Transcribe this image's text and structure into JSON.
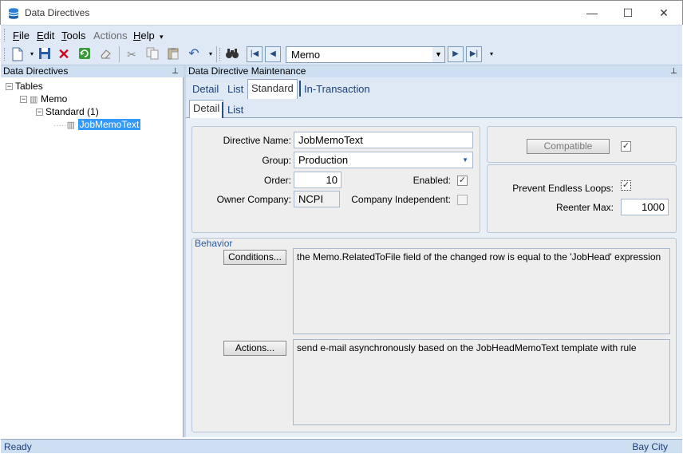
{
  "window": {
    "title": "Data Directives",
    "icon": "database-icon",
    "minimize": "—",
    "maximize": "☐",
    "close": "✕"
  },
  "menu": {
    "items": [
      {
        "label": "File",
        "accel": "F",
        "rest": "ile"
      },
      {
        "label": "Edit",
        "accel": "E",
        "rest": "dit"
      },
      {
        "label": "Tools",
        "accel": "T",
        "rest": "ools"
      },
      {
        "label": "Actions",
        "accel": "",
        "rest": "Actions"
      },
      {
        "label": "Help",
        "accel": "H",
        "rest": "elp"
      }
    ],
    "overflow": "▾"
  },
  "toolbar": {
    "record_value": "Memo",
    "overflow": "▾"
  },
  "left_panel": {
    "title": "Data Directives",
    "pin": "⊥",
    "tree": {
      "root": "Tables",
      "table": "Memo",
      "group": "Standard (1)",
      "directive": "JobMemoText"
    }
  },
  "right_panel": {
    "title": "Data Directive Maintenance",
    "pin": "⊥",
    "tabs": [
      "Detail",
      "List",
      "Standard",
      "In-Transaction"
    ],
    "active_tab": "Standard",
    "subtabs": [
      "Detail",
      "List"
    ],
    "active_subtab": "Detail"
  },
  "form": {
    "directive_name_label": "Directive Name:",
    "directive_name": "JobMemoText",
    "group_label": "Group:",
    "group": "Production",
    "order_label": "Order:",
    "order": "10",
    "enabled_label": "Enabled:",
    "enabled": true,
    "owner_company_label": "Owner Company:",
    "owner_company": "NCPI",
    "company_independent_label": "Company Independent:",
    "company_independent": false,
    "compatible_button": "Compatible",
    "compatible_checked": true,
    "prevent_loops_label": "Prevent Endless Loops:",
    "prevent_loops": true,
    "reenter_max_label": "Reenter Max:",
    "reenter_max": "1000"
  },
  "behavior": {
    "label": "Behavior",
    "conditions_button": "Conditions...",
    "conditions_text": "the Memo.RelatedToFile field of the changed row is equal to the 'JobHead' expression",
    "actions_button": "Actions...",
    "actions_text": "send e-mail asynchronously based on the JobHeadMemoText template with rule"
  },
  "status": {
    "left": "Ready",
    "right": "Bay City"
  }
}
